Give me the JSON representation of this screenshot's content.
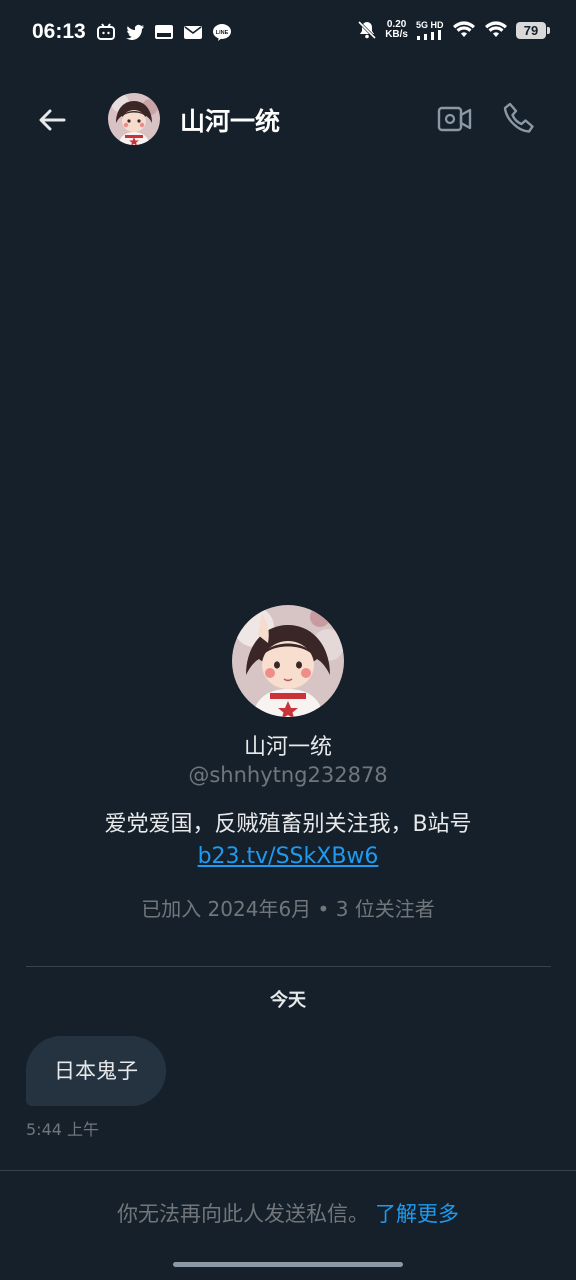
{
  "status_bar": {
    "time": "06:13",
    "left_icons": [
      "bilibili-icon",
      "twitter-icon",
      "pay-icon",
      "mail-icon",
      "line-icon"
    ],
    "net_speed_value": "0.20",
    "net_speed_unit": "KB/s",
    "network_label": "5G HD",
    "battery": "79"
  },
  "header": {
    "title": "山河一统"
  },
  "profile": {
    "name": "山河一统",
    "handle": "@shnhytng232878",
    "bio_text": "爱党爱国，反贼殖畜别关注我，B站号",
    "bio_link": "b23.tv/SSkXBw6",
    "meta": "已加入 2024年6月 • 3 位关注者"
  },
  "conversation": {
    "day_label": "今天",
    "message_text": "日本鬼子",
    "message_time": "5:44 上午"
  },
  "footer": {
    "notice": "你无法再向此人发送私信。",
    "learn_more": "了解更多"
  },
  "colors": {
    "background": "#15202b",
    "accent": "#1d9bf0",
    "bubble": "#253341",
    "muted": "#71767b"
  }
}
